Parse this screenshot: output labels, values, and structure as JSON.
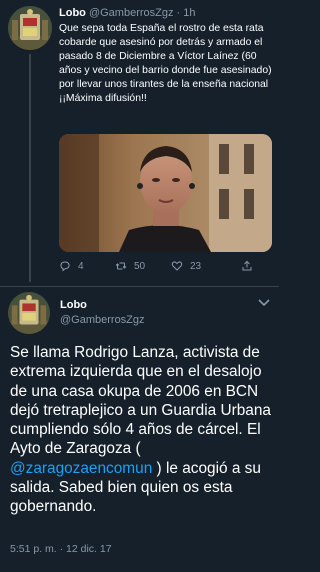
{
  "context_tweet": {
    "name": "Lobo",
    "handle": "@GamberrosZgz",
    "separator": "·",
    "time": "1h",
    "text": "Que sepa toda España el rostro de esta rata cobarde que asesinó por detrás y armado el pasado 8 de Diciembre a Víctor Laínez (60 años y vecino del barrio donde fue asesinado) por llevar unos tirantes de la enseña nacional ¡¡Máxima difusión!!",
    "actions": {
      "reply_count": "4",
      "retweet_count": "50",
      "like_count": "23"
    },
    "icons": {
      "reply": "reply-icon",
      "retweet": "retweet-icon",
      "like": "heart-icon",
      "share": "share-icon"
    }
  },
  "main_tweet": {
    "name": "Lobo",
    "handle": "@GamberrosZgz",
    "text_before_mention": "Se llama Rodrigo Lanza, activista de extrema izquierda que en el desalojo de una casa okupa de 2006 en BCN dejó tretraplejico a un Guardia Urbana cumpliendo sólo 4 años de cárcel. El Ayto de Zaragoza ( ",
    "mention": "@zaragozaencomun",
    "text_after_mention": " ) le acogió a su salida. Sabed bien quien os esta gobernando.",
    "timestamp": "5:51 p. m. · 12 dic. 17",
    "menu_icon": "chevron-down-icon"
  },
  "colors": {
    "background": "#15202b",
    "text": "#ffffff",
    "muted": "#8899a6",
    "link": "#1da1f2",
    "divider": "#38444d"
  }
}
